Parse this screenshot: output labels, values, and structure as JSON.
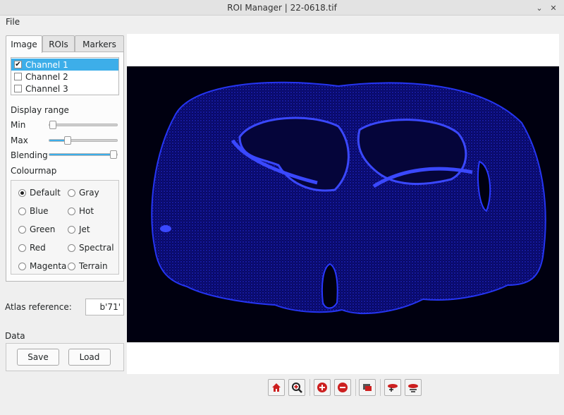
{
  "window": {
    "title": "ROI Manager   |   22-0618.tif"
  },
  "menu": {
    "file": "File"
  },
  "tabs": [
    "Image",
    "ROIs",
    "Markers"
  ],
  "channels": [
    {
      "label": "Channel 1",
      "checked": true,
      "selected": true
    },
    {
      "label": "Channel 2",
      "checked": false,
      "selected": false
    },
    {
      "label": "Channel 3",
      "checked": false,
      "selected": false
    }
  ],
  "display_range": {
    "heading": "Display range",
    "min_label": "Min",
    "max_label": "Max",
    "blending_label": "Blending",
    "min_value": 0.0,
    "max_value": 0.24,
    "blending_value": 1.0
  },
  "colourmap": {
    "heading": "Colourmap",
    "options": [
      "Default",
      "Gray",
      "Blue",
      "Hot",
      "Green",
      "Jet",
      "Red",
      "Spectral",
      "Magenta",
      "Terrain"
    ],
    "selected": "Default"
  },
  "atlas": {
    "label": "Atlas reference:",
    "value": "b'71'"
  },
  "data_section": {
    "label": "Data",
    "save": "Save",
    "load": "Load"
  },
  "toolbar_icons": [
    "home-icon",
    "zoom-region-icon",
    "zoom-in-icon",
    "zoom-out-icon",
    "layers-icon",
    "add-roi-icon",
    "remove-roi-icon"
  ],
  "colors": {
    "accent": "#3daee9",
    "image_background": "#000010",
    "tissue_stain": "#1a2aff",
    "toolbar_icon_red": "#cc2020"
  }
}
